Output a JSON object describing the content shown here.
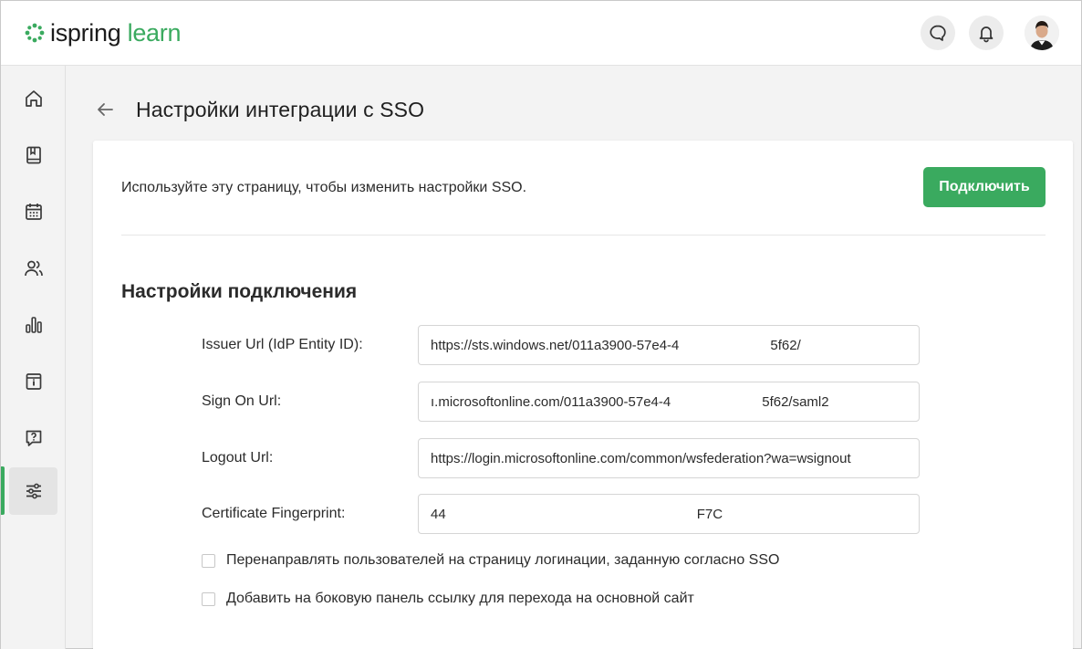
{
  "app": {
    "logo_word1": "ispring",
    "logo_word2": "learn"
  },
  "header": {
    "chat_icon": "chat-bubble-icon",
    "bell_icon": "bell-icon"
  },
  "sidebar": {
    "items": [
      {
        "icon": "home-icon"
      },
      {
        "icon": "book-icon"
      },
      {
        "icon": "calendar-icon"
      },
      {
        "icon": "users-icon"
      },
      {
        "icon": "bar-chart-icon"
      },
      {
        "icon": "info-icon"
      },
      {
        "icon": "question-icon"
      },
      {
        "icon": "sliders-icon",
        "active": true
      }
    ]
  },
  "page": {
    "title": "Настройки интеграции с SSO",
    "intro": "Используйте эту страницу, чтобы изменить настройки SSO.",
    "connect_label": "Подключить",
    "section_title": "Настройки подключения"
  },
  "fields": {
    "issuer": {
      "label": "Issuer Url (IdP Entity ID):",
      "value": "https://sts.windows.net/011a3900-57e4-4                        5f62/"
    },
    "signon": {
      "label": "Sign On Url:",
      "value": "ı.microsoftonline.com/011a3900-57e4-4                        5f62/saml2"
    },
    "logout": {
      "label": "Logout Url:",
      "value": "https://login.microsoftonline.com/common/wsfederation?wa=wsignout"
    },
    "cert": {
      "label": "Certificate Fingerprint:",
      "value": "44                                                                  F7C"
    }
  },
  "options": {
    "redirect": "Перенаправлять пользователей на страницу логинации, заданную согласно SSO",
    "sidebar_link": "Добавить на боковую панель ссылку для перехода на основной сайт"
  },
  "colors": {
    "accent": "#3aaa5f",
    "background": "#f3f3f3"
  }
}
